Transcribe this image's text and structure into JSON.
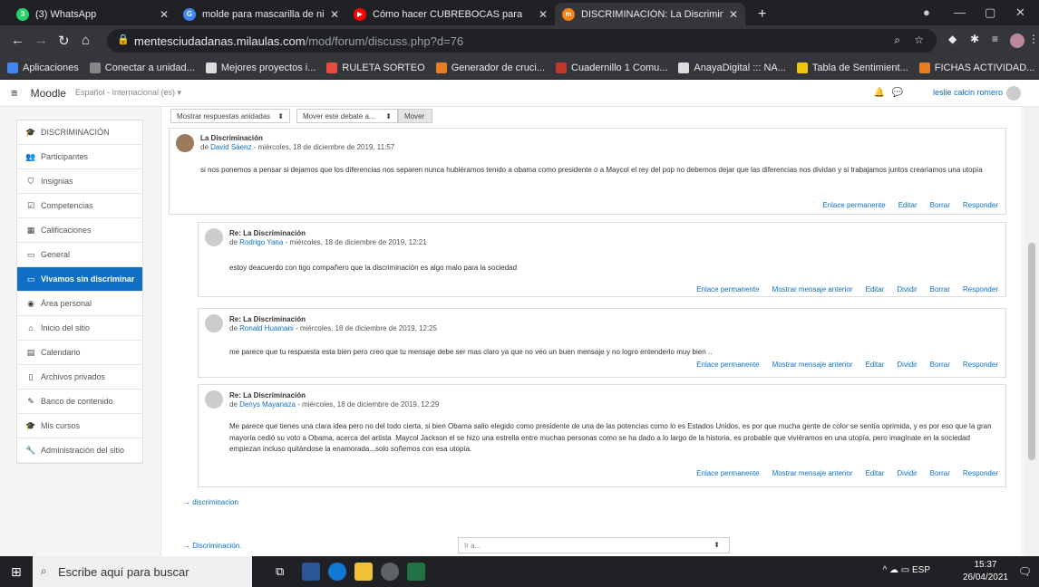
{
  "browser": {
    "tabs": [
      {
        "title": "(3) WhatsApp",
        "fav": "#25d366",
        "glyph": "3",
        "active": false
      },
      {
        "title": "molde para mascarilla de niños -",
        "fav": "#4285f4",
        "glyph": "G",
        "active": false
      },
      {
        "title": "Cómo hacer CUBREBOCAS para",
        "fav": "#ff0000",
        "glyph": "▶",
        "active": false
      },
      {
        "title": "DISCRIMINACIÓN: La Discriminac",
        "fav": "#f98012",
        "glyph": "m",
        "active": true
      }
    ],
    "new_tab": "+",
    "url_host": "mentesciudadanas.milaulas.com",
    "url_path": "/mod/forum/discuss.php?d=76"
  },
  "bookmarks": [
    {
      "label": "Aplicaciones",
      "color": "#4285f4"
    },
    {
      "label": "Conectar a unidad...",
      "color": "#888"
    },
    {
      "label": "Mejores proyectos i...",
      "color": "#ddd"
    },
    {
      "label": "RULETA SORTEO",
      "color": "#e74c3c"
    },
    {
      "label": "Generador de cruci...",
      "color": "#e67e22"
    },
    {
      "label": "Cuadernillo 1 Comu...",
      "color": "#c0392b"
    },
    {
      "label": "AnayaDigital ::: NA...",
      "color": "#ddd"
    },
    {
      "label": "Tabla de Sentimient...",
      "color": "#f1c40f"
    },
    {
      "label": "FICHAS ACTIVIDAD...",
      "color": "#e67e22"
    }
  ],
  "moodle": {
    "brand": "Moodle",
    "language": "Español - Internacional (es) ▾",
    "user": "leslie calcin romero"
  },
  "sidebar": [
    {
      "label": "DISCRIMINACIÓN",
      "icon": "🎓",
      "active": false
    },
    {
      "label": "Participantes",
      "icon": "👥",
      "active": false
    },
    {
      "label": "Insignias",
      "icon": "⛉",
      "active": false
    },
    {
      "label": "Competencias",
      "icon": "☑",
      "active": false
    },
    {
      "label": "Calificaciones",
      "icon": "▦",
      "active": false
    },
    {
      "label": "General",
      "icon": "▭",
      "active": false
    },
    {
      "label": "Vivamos sin discriminar",
      "icon": "▭",
      "active": true
    },
    {
      "label": "Área personal",
      "icon": "◉",
      "active": false
    },
    {
      "label": "Inicio del sitio",
      "icon": "⌂",
      "active": false
    },
    {
      "label": "Calendario",
      "icon": "▤",
      "active": false
    },
    {
      "label": "Archivos privados",
      "icon": "▯",
      "active": false
    },
    {
      "label": "Banco de contenido",
      "icon": "✎",
      "active": false
    },
    {
      "label": "Mis cursos",
      "icon": "🎓",
      "active": false
    },
    {
      "label": "Administración del sitio",
      "icon": "🔧",
      "active": false
    }
  ],
  "controls": {
    "display_mode": "Mostrar respuestas anidadas",
    "move_select": "Mover este debate a...",
    "move_button": "Mover"
  },
  "posts": [
    {
      "subject": "La Discriminación",
      "by_prefix": "de",
      "author": "David Sáenz",
      "date": "- miércoles, 18 de diciembre de 2019, 11:57",
      "message": "si nos ponemos a pensar si dejamos que los diferencias nos separen nunca hubiéramos tenido a obama como presidente  o a Maycol el rey del pop no debemos dejar que las diferencias nos dividan y si trabajamos juntos crearíamos una utopía",
      "commands": [
        "Enlace permanente",
        "Editar",
        "Borrar",
        "Responder"
      ]
    },
    {
      "subject": "Re: La Discriminación",
      "by_prefix": "de",
      "author": "Rodrigo Yana",
      "date": "- miércoles, 18 de diciembre de 2019, 12:21",
      "message": "estoy deacuerdo con tigo compañero que la discriminación es algo malo para la sociedad",
      "commands": [
        "Enlace permanente",
        "Mostrar mensaje anterior",
        "Editar",
        "Dividir",
        "Borrar",
        "Responder"
      ]
    },
    {
      "subject": "Re: La Discriminación",
      "by_prefix": "de",
      "author": "Ronald Huamani",
      "date": "- miércoles, 18 de diciembre de 2019, 12:25",
      "message": "me parece que tu respuesta esta bien pero creo que tu mensaje debe ser mas claro ya que no veo un buen mensaje y no logro entenderlo muy bien ..",
      "commands": [
        "Enlace permanente",
        "Mostrar mensaje anterior",
        "Editar",
        "Dividir",
        "Borrar",
        "Responder"
      ]
    },
    {
      "subject": "Re: La Discriminación",
      "by_prefix": "de",
      "author": "Denys Mayanaza",
      "date": "- miércoles, 18 de diciembre de 2019, 12:29",
      "message": "Me parece que tienes una clara idea pero no del todo cierta, si bien Obama salio elegido como presidente de una de las potencias  como lo es Estados Unidos, es por que mucha gente de color se sentía oprimida, y es por eso que la gran mayoría cedió su voto a Obama,  acerca del artista .Maycol Jackson el se hizo una estrella entre muchas personas como se ha dado a lo largo de la historia, es probable que viviéramos en una utopía, pero imagínate en la sociedad empiezan incluso quitándose la enamorada...solo soñemos con esa utopía.",
      "commands": [
        "Enlace permanente",
        "Mostrar mensaje anterior",
        "Editar",
        "Dividir",
        "Borrar",
        "Responder"
      ]
    }
  ],
  "nav": {
    "next_link": "→ discriminacion",
    "prev_link": "→ Discriminación.",
    "jump_placeholder": "Ir a...",
    "jump_caret": "⬍"
  },
  "taskbar": {
    "search_placeholder": "Escribe aquí para buscar",
    "tray": "^  ☁  ▭  ESP",
    "time": "15:37",
    "date": "26/04/2021"
  }
}
